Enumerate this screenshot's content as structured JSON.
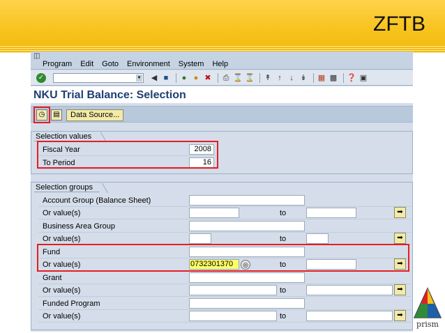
{
  "slide_title": "ZFTB",
  "menu": [
    "Program",
    "Edit",
    "Goto",
    "Environment",
    "System",
    "Help"
  ],
  "screen_title": "NKU Trial Balance: Selection",
  "app_toolbar": {
    "data_source": "Data Source..."
  },
  "selection_values": {
    "title": "Selection values",
    "fiscal_year_label": "Fiscal Year",
    "fiscal_year": "2008",
    "to_period_label": "To Period",
    "to_period": "16"
  },
  "selection_groups": {
    "title": "Selection groups",
    "to_label": "to",
    "rows": [
      {
        "label": "Account Group (Balance Sheet)"
      },
      {
        "label": "Or value(s)",
        "value": ""
      },
      {
        "label": "Business Area Group"
      },
      {
        "label": "Or value(s)",
        "value": ""
      },
      {
        "label": "Fund"
      },
      {
        "label": "Or value(s)",
        "value": "0732301370"
      },
      {
        "label": "Grant"
      },
      {
        "label": "Or value(s)",
        "value": ""
      },
      {
        "label": "Funded Program"
      },
      {
        "label": "Or value(s)",
        "value": ""
      }
    ]
  },
  "logo_text": "prism"
}
